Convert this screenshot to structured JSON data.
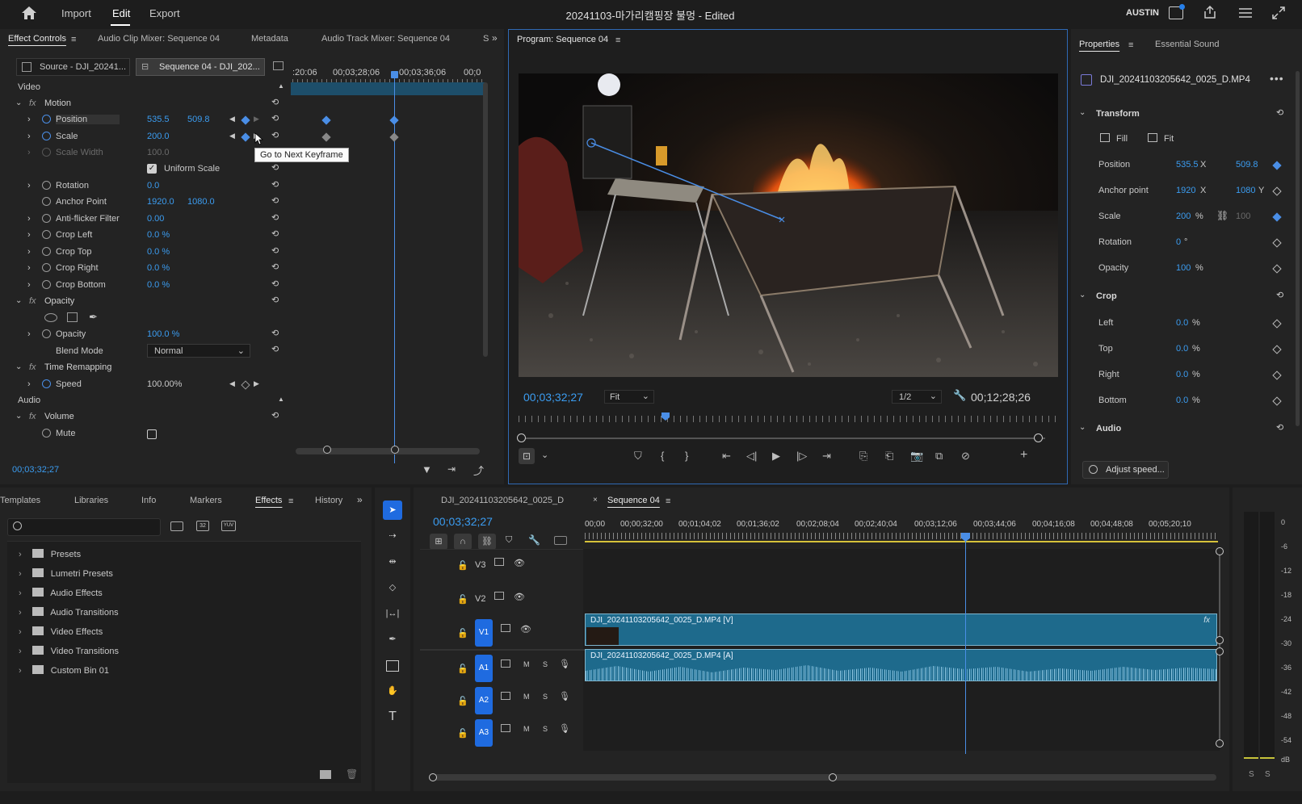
{
  "topbar": {
    "nav": [
      "Import",
      "Edit",
      "Export"
    ],
    "title": "20241103-마가리캠핑장 불멍 - Edited",
    "user": "AUSTIN"
  },
  "effect_controls": {
    "tabs": [
      "Effect Controls",
      "Audio Clip Mixer: Sequence 04",
      "Metadata",
      "Audio Track Mixer: Sequence 04",
      "S"
    ],
    "source_tab": "Source - DJI_20241...",
    "sequence_tab": "Sequence 04 - DJI_202...",
    "timecodes": [
      ":20:06",
      "00;03;28;06",
      "00;03;36;06",
      "00;0"
    ],
    "video_header": "Video",
    "audio_header": "Audio",
    "motion": "Motion",
    "props": [
      {
        "name": "Position",
        "v1": "535.5",
        "v2": "509.8"
      },
      {
        "name": "Scale",
        "v1": "200.0"
      },
      {
        "name": "Scale Width",
        "v1": "100.0"
      },
      {
        "name": "Uniform Scale"
      },
      {
        "name": "Rotation",
        "v1": "0.0"
      },
      {
        "name": "Anchor Point",
        "v1": "1920.0",
        "v2": "1080.0"
      },
      {
        "name": "Anti-flicker Filter",
        "v1": "0.00"
      },
      {
        "name": "Crop Left",
        "v1": "0.0 %"
      },
      {
        "name": "Crop Top",
        "v1": "0.0 %"
      },
      {
        "name": "Crop Right",
        "v1": "0.0 %"
      },
      {
        "name": "Crop Bottom",
        "v1": "0.0 %"
      }
    ],
    "opacity_group": "Opacity",
    "opacity_prop": "Opacity",
    "opacity_value": "100.0 %",
    "blend_mode_label": "Blend Mode",
    "blend_mode_value": "Normal",
    "time_remap": "Time Remapping",
    "speed_label": "Speed",
    "speed_value": "100.00%",
    "volume": "Volume",
    "mute": "Mute",
    "tooltip": "Go to Next Keyframe",
    "current_time": "00;03;32;27"
  },
  "program": {
    "tab": "Program: Sequence 04",
    "timecode": "00;03;32;27",
    "fit": "Fit",
    "resolution": "1/2",
    "duration": "00;12;28;26"
  },
  "properties": {
    "tabs": [
      "Properties",
      "Essential Sound"
    ],
    "clip": "DJI_20241103205642_0025_D.MP4",
    "transform": "Transform",
    "fill": "Fill",
    "fit": "Fit",
    "position_label": "Position",
    "position_x": "535.5",
    "position_y": "509.8",
    "anchor_label": "Anchor point",
    "anchor_x": "1920",
    "anchor_y": "1080",
    "scale_label": "Scale",
    "scale_value": "200",
    "scale_value2": "100",
    "rotation_label": "Rotation",
    "rotation_value": "0",
    "opacity_label": "Opacity",
    "opacity_value": "100",
    "crop": "Crop",
    "crop_rows": [
      {
        "label": "Left",
        "value": "0.0"
      },
      {
        "label": "Top",
        "value": "0.0"
      },
      {
        "label": "Right",
        "value": "0.0"
      },
      {
        "label": "Bottom",
        "value": "0.0"
      }
    ],
    "audio": "Audio",
    "adjust_speed": "Adjust speed...",
    "unit_x": "X",
    "unit_y": "Y",
    "unit_pct": "%",
    "unit_deg": "°"
  },
  "effects_panel": {
    "tabs": [
      "Templates",
      "Libraries",
      "Info",
      "Markers",
      "Effects",
      "History"
    ],
    "folders": [
      "Presets",
      "Lumetri Presets",
      "Audio Effects",
      "Audio Transitions",
      "Video Effects",
      "Video Transitions",
      "Custom Bin 01"
    ],
    "badge_32": "32",
    "badge_yuv": "YUV"
  },
  "timeline": {
    "tabs": [
      "DJI_20241103205642_0025_D",
      "Sequence 04"
    ],
    "timecode": "00;03;32;27",
    "ruler": [
      "00;00",
      "00;00;32;00",
      "00;01;04;02",
      "00;01;36;02",
      "00;02;08;04",
      "00;02;40;04",
      "00;03;12;06",
      "00;03;44;06",
      "00;04;16;08",
      "00;04;48;08",
      "00;05;20;10"
    ],
    "tracks": [
      "V3",
      "V2",
      "V1",
      "A1",
      "A2",
      "A3"
    ],
    "clip_v": "DJI_20241103205642_0025_D.MP4 [V]",
    "clip_a": "DJI_20241103205642_0025_D.MP4 [A]",
    "m": "M",
    "s": "S"
  },
  "meter": {
    "labels": [
      "0",
      "-6",
      "-12",
      "-18",
      "-24",
      "-30",
      "-36",
      "-42",
      "-48",
      "-54",
      "dB"
    ],
    "solo": [
      "S",
      "S"
    ]
  }
}
